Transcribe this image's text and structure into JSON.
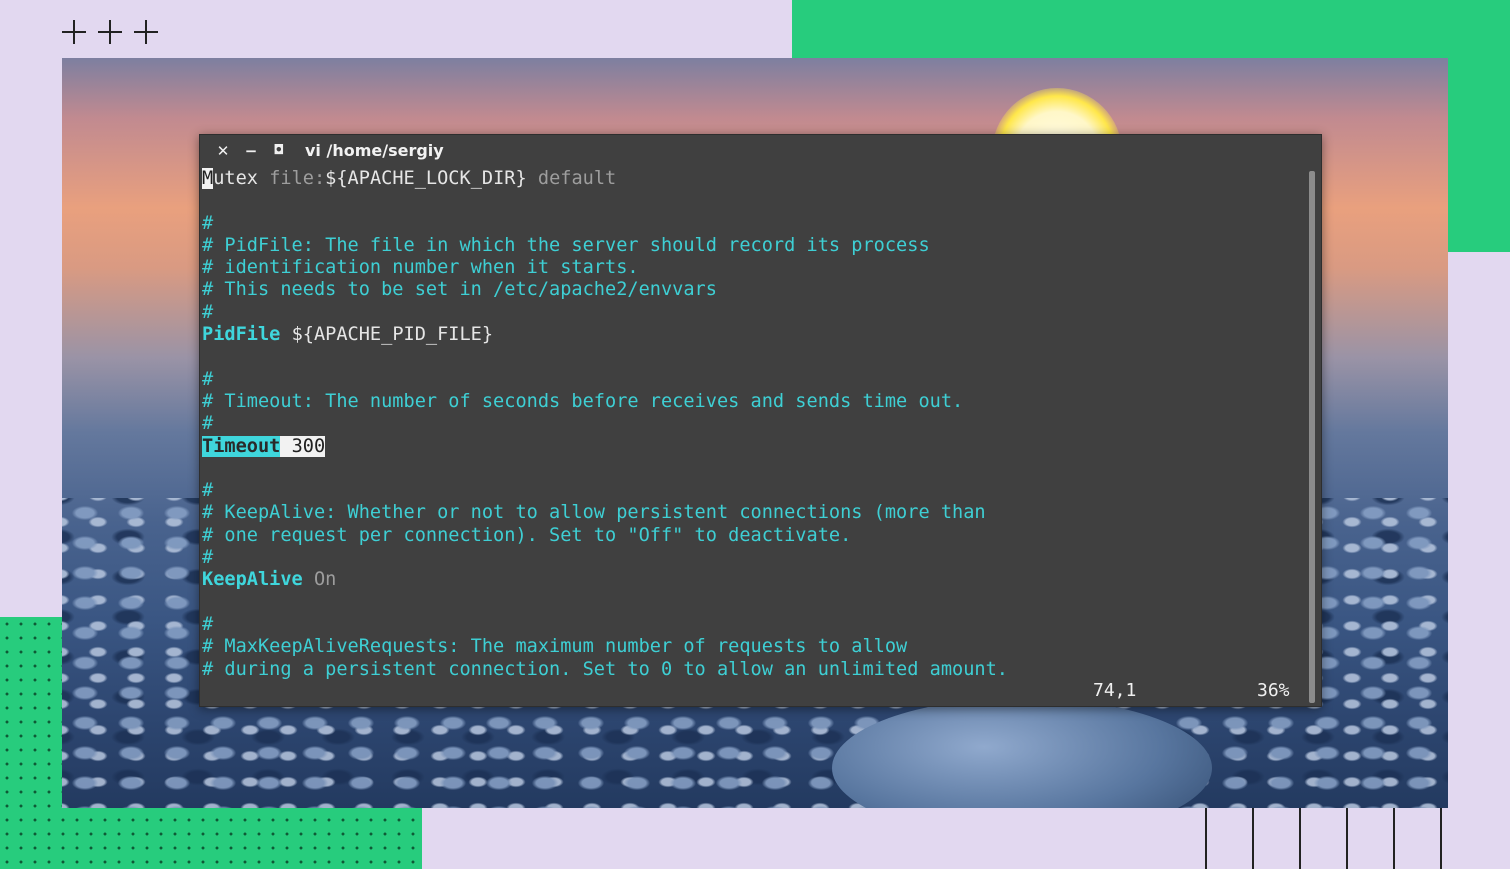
{
  "window": {
    "title": "vi /home/sergiy",
    "close_glyph": "✕",
    "minimize_glyph": "−",
    "maximize_glyph": "◘"
  },
  "editor": {
    "lines": [
      {
        "segments": [
          {
            "text": "M",
            "style": "cursor"
          },
          {
            "text": "utex ",
            "style": "plain"
          },
          {
            "text": "file:",
            "style": "dim"
          },
          {
            "text": "${APACHE_LOCK_DIR} ",
            "style": "plain"
          },
          {
            "text": "default",
            "style": "dim"
          }
        ]
      },
      {
        "segments": []
      },
      {
        "segments": [
          {
            "text": "#",
            "style": "cmt"
          }
        ]
      },
      {
        "segments": [
          {
            "text": "# PidFile: The file in which the server should record its process",
            "style": "cmt"
          }
        ]
      },
      {
        "segments": [
          {
            "text": "# identification number when it starts.",
            "style": "cmt"
          }
        ]
      },
      {
        "segments": [
          {
            "text": "# This needs to be set in /etc/apache2/envvars",
            "style": "cmt"
          }
        ]
      },
      {
        "segments": [
          {
            "text": "#",
            "style": "cmt"
          }
        ]
      },
      {
        "segments": [
          {
            "text": "PidFile",
            "style": "kw"
          },
          {
            "text": " ${APACHE_PID_FILE}",
            "style": "plain"
          }
        ]
      },
      {
        "segments": []
      },
      {
        "segments": [
          {
            "text": "#",
            "style": "cmt"
          }
        ]
      },
      {
        "segments": [
          {
            "text": "# Timeout: The number of seconds before receives and sends time out.",
            "style": "cmt"
          }
        ]
      },
      {
        "segments": [
          {
            "text": "#",
            "style": "cmt"
          }
        ]
      },
      {
        "segments": [
          {
            "text": "Timeout",
            "style": "hl-kw"
          },
          {
            "text": " 300",
            "style": "hl-val"
          }
        ]
      },
      {
        "segments": []
      },
      {
        "segments": [
          {
            "text": "#",
            "style": "cmt"
          }
        ]
      },
      {
        "segments": [
          {
            "text": "# KeepAlive: Whether or not to allow persistent connections (more than",
            "style": "cmt"
          }
        ]
      },
      {
        "segments": [
          {
            "text": "# one request per connection). Set to \"Off\" to deactivate.",
            "style": "cmt"
          }
        ]
      },
      {
        "segments": [
          {
            "text": "#",
            "style": "cmt"
          }
        ]
      },
      {
        "segments": [
          {
            "text": "KeepAlive",
            "style": "kw"
          },
          {
            "text": " On",
            "style": "dim"
          }
        ]
      },
      {
        "segments": []
      },
      {
        "segments": [
          {
            "text": "#",
            "style": "cmt"
          }
        ]
      },
      {
        "segments": [
          {
            "text": "# MaxKeepAliveRequests: The maximum number of requests to allow",
            "style": "cmt"
          }
        ]
      },
      {
        "segments": [
          {
            "text": "# during a persistent connection. Set to 0 to allow an unlimited amount.",
            "style": "cmt"
          }
        ]
      }
    ]
  },
  "statusline": {
    "cursor_position": "74,1",
    "scroll_percent": "36%"
  },
  "colors": {
    "terminal_bg": "#404040",
    "comment": "#3ecfd4",
    "keyword": "#3fd6dc",
    "accent_green": "#27cc7d",
    "backdrop": "#e2d8f0"
  }
}
